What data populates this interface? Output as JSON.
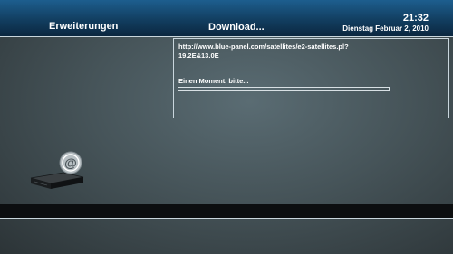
{
  "header": {
    "left_title": "Erweiterungen",
    "center_title": "Download...",
    "time": "21:32",
    "date": "Dienstag Februar 2, 2010"
  },
  "download": {
    "url": "http://www.blue-panel.com/satellites/e2-satellites.pl?19.2E&13.0E",
    "status": "Einen Moment, bitte...",
    "progress": 0.0
  },
  "icons": {
    "logo": "receiver-at-icon"
  },
  "colors": {
    "header_blue": "#1d5e8e",
    "background": "#465459",
    "frame": "#c9d6dd",
    "footer": "#0c0e10"
  }
}
